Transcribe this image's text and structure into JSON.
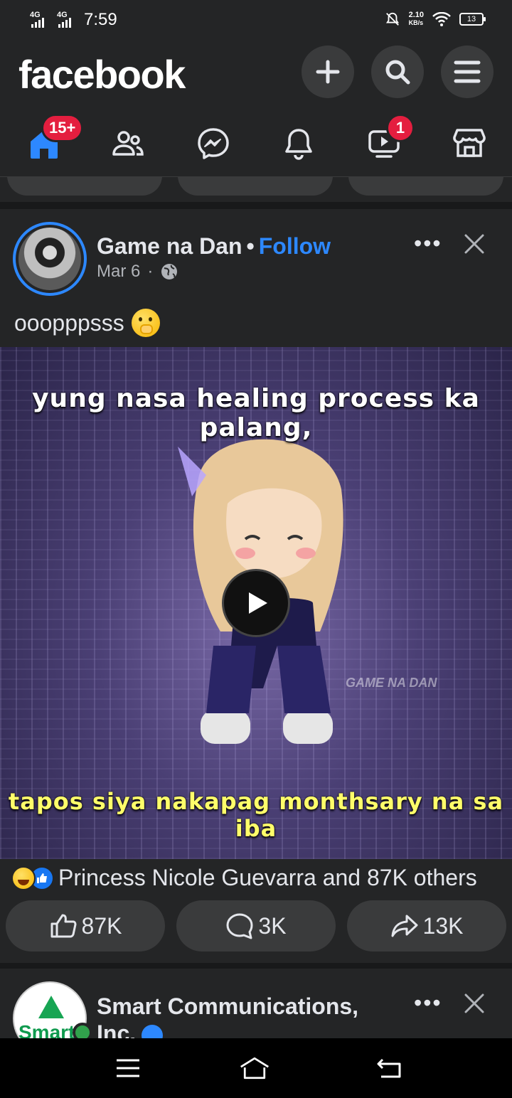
{
  "status_bar": {
    "net1": "4G",
    "net2": "4G",
    "time": "7:59",
    "speed_value": "2.10",
    "speed_unit": "KB/s",
    "battery": "13"
  },
  "header": {
    "logo": "facebook",
    "icons": [
      "plus-icon",
      "search-icon",
      "menu-icon"
    ]
  },
  "nav": {
    "home_badge": "15+",
    "video_badge": "1",
    "items": [
      "home-icon",
      "friends-icon",
      "messenger-icon",
      "bell-icon",
      "video-icon",
      "marketplace-icon"
    ]
  },
  "post": {
    "author": "Game na Dan",
    "separator": "•",
    "follow": "Follow",
    "date": "Mar 6",
    "meta_dot": "·",
    "more": "•••",
    "caption": "oooppps ss",
    "caption_exact": "ooopppsss",
    "video": {
      "top_text": "yung nasa healing process ka palang,",
      "bottom_text": "tapos siya nakapag monthsary na sa iba",
      "watermark": "GAME NA DAN"
    },
    "reactions_text": "Princess Nicole Guevarra and 87K others",
    "actions": {
      "like": "87K",
      "comment": "3K",
      "share": "13K"
    }
  },
  "post2": {
    "author": "Smart Communications, Inc.",
    "avatar_text": "Smart",
    "more": "•••"
  },
  "colors": {
    "bg": "#242526",
    "accent": "#2d88ff",
    "badge": "#e41e3f"
  }
}
